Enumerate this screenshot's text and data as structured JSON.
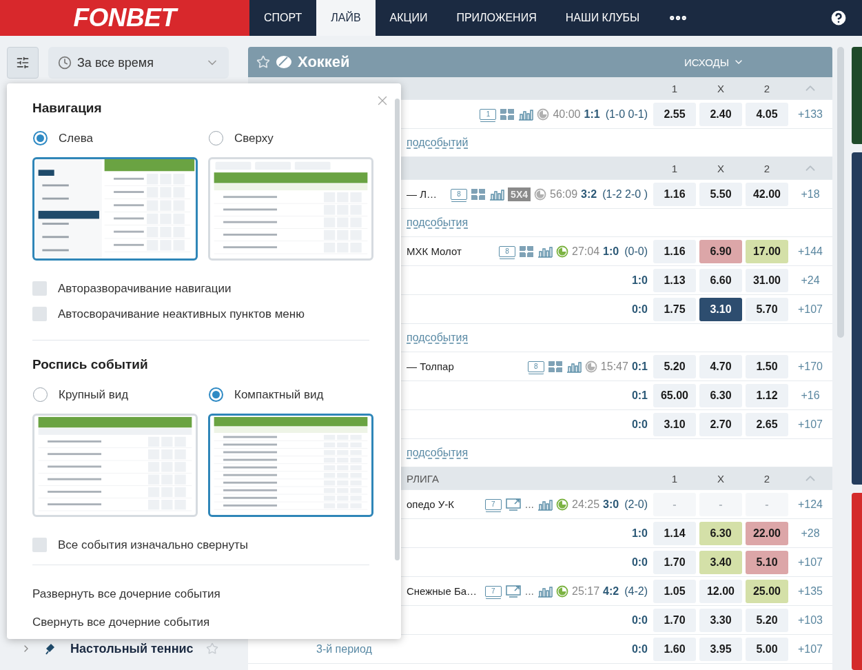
{
  "header": {
    "logo": "FONBET",
    "tabs": [
      {
        "label": "СПОРТ",
        "selected": false
      },
      {
        "label": "ЛАЙВ",
        "selected": true
      },
      {
        "label": "АКЦИИ",
        "selected": false
      },
      {
        "label": "ПРИЛОЖЕНИЯ",
        "selected": false
      },
      {
        "label": "НАШИ КЛУБЫ",
        "selected": false
      }
    ]
  },
  "sidebar": {
    "period_filter": "За все время",
    "bottom_item": "Настольный теннис"
  },
  "main": {
    "sport": "Хоккей",
    "market": "ИСХОДЫ",
    "blocks": [
      {
        "kind": "league",
        "columns": [
          "1",
          "X",
          "2"
        ]
      },
      {
        "kind": "event",
        "icons": [
          {
            "kind": "tv",
            "label": "1"
          },
          {
            "kind": "field"
          },
          {
            "kind": "stats"
          }
        ],
        "clock_live": false,
        "time": "40:00",
        "score": "1:1",
        "period": "(1-0 0-1)",
        "suspended": false,
        "odds": [
          {
            "value": "2.55",
            "selected": false,
            "color": "#eef2f6"
          },
          {
            "value": "2.40",
            "selected": false,
            "color": "#eef2f6"
          },
          {
            "value": "4.05",
            "selected": false,
            "color": "#eef2f6"
          }
        ],
        "more": "+133"
      },
      {
        "kind": "link",
        "text": "подсобытий"
      },
      {
        "kind": "league",
        "columns": [
          "1",
          "X",
          "2"
        ]
      },
      {
        "kind": "event",
        "name": "— Л…",
        "icons": [
          {
            "kind": "tv",
            "label": "8"
          },
          {
            "kind": "field"
          },
          {
            "kind": "stats"
          },
          {
            "kind": "badge",
            "label": "5X4"
          }
        ],
        "clock_live": false,
        "time": "56:09",
        "score": "3:2",
        "period": "(1-2 2-0 )",
        "suspended": false,
        "odds": [
          {
            "value": "1.16",
            "selected": false,
            "color": "#eef2f6"
          },
          {
            "value": "5.50",
            "selected": false,
            "color": "#eef2f6"
          },
          {
            "value": "42.00",
            "selected": false,
            "color": "#eef2f6"
          }
        ],
        "more": "+18"
      },
      {
        "kind": "link",
        "text": "подсобытия"
      },
      {
        "kind": "event",
        "name": "МХК Молот",
        "icons": [
          {
            "kind": "tv",
            "label": "8"
          },
          {
            "kind": "field"
          },
          {
            "kind": "stats"
          }
        ],
        "clock_live": true,
        "time": "27:04",
        "score": "1:0",
        "period": "(0-0)",
        "suspended": false,
        "odds": [
          {
            "value": "1.16",
            "selected": false,
            "color": "#eef2f6"
          },
          {
            "value": "6.90",
            "selected": false,
            "color": "#dca6a8"
          },
          {
            "value": "17.00",
            "selected": false,
            "color": "#d4e0a8"
          }
        ],
        "more": "+144"
      },
      {
        "kind": "sub",
        "score": "1:0",
        "odds": [
          {
            "value": "1.13",
            "selected": false,
            "color": "#eef2f6"
          },
          {
            "value": "6.60",
            "selected": false,
            "color": "#eef2f6"
          },
          {
            "value": "31.00",
            "selected": false,
            "color": "#eef2f6"
          }
        ],
        "more": "+24"
      },
      {
        "kind": "sub",
        "score": "0:0",
        "odds": [
          {
            "value": "1.75",
            "selected": false,
            "color": "#eef2f6"
          },
          {
            "value": "3.10",
            "selected": true,
            "color": "#2d4d6f"
          },
          {
            "value": "5.70",
            "selected": false,
            "color": "#eef2f6"
          }
        ],
        "more": "+107"
      },
      {
        "kind": "link",
        "text": "подсобытия"
      },
      {
        "kind": "event",
        "name": "— Толпар",
        "icons": [
          {
            "kind": "tv",
            "label": "8"
          },
          {
            "kind": "field"
          },
          {
            "kind": "stats"
          }
        ],
        "clock_live": false,
        "time": "15:47",
        "score": "0:1",
        "suspended": false,
        "odds": [
          {
            "value": "5.20",
            "selected": false,
            "color": "#eef2f6"
          },
          {
            "value": "4.70",
            "selected": false,
            "color": "#eef2f6"
          },
          {
            "value": "1.50",
            "selected": false,
            "color": "#eef2f6"
          }
        ],
        "more": "+170"
      },
      {
        "kind": "sub",
        "score": "0:1",
        "odds": [
          {
            "value": "65.00",
            "selected": false,
            "color": "#eef2f6"
          },
          {
            "value": "6.30",
            "selected": false,
            "color": "#eef2f6"
          },
          {
            "value": "1.12",
            "selected": false,
            "color": "#eef2f6"
          }
        ],
        "more": "+16"
      },
      {
        "kind": "sub",
        "score": "0:0",
        "odds": [
          {
            "value": "3.10",
            "selected": false,
            "color": "#eef2f6"
          },
          {
            "value": "2.70",
            "selected": false,
            "color": "#eef2f6"
          },
          {
            "value": "2.65",
            "selected": false,
            "color": "#eef2f6"
          }
        ],
        "more": "+107"
      },
      {
        "kind": "link",
        "text": "подсобытия"
      },
      {
        "kind": "league",
        "title": "РЛИГА",
        "columns": [
          "1",
          "X",
          "2"
        ]
      },
      {
        "kind": "event",
        "name": "опедо У-К",
        "icons": [
          {
            "kind": "tv",
            "label": "7"
          },
          {
            "kind": "screen"
          },
          {
            "kind": "more",
            "label": "..."
          },
          {
            "kind": "stats"
          }
        ],
        "clock_live": true,
        "time": "24:25",
        "score": "3:0",
        "period": "(2-0)",
        "suspended": true,
        "odds": [
          {
            "value": "-",
            "selected": false,
            "color": "#eef2f6"
          },
          {
            "value": "-",
            "selected": false,
            "color": "#eef2f6"
          },
          {
            "value": "-",
            "selected": false,
            "color": "#eef2f6"
          }
        ],
        "more": "+124"
      },
      {
        "kind": "sub",
        "score": "1:0",
        "odds": [
          {
            "value": "1.14",
            "selected": false,
            "color": "#eef2f6"
          },
          {
            "value": "6.30",
            "selected": false,
            "color": "#d4e0a8"
          },
          {
            "value": "22.00",
            "selected": false,
            "color": "#dca6a8"
          }
        ],
        "more": "+28"
      },
      {
        "kind": "sub",
        "score": "0:0",
        "odds": [
          {
            "value": "1.70",
            "selected": false,
            "color": "#eef2f6"
          },
          {
            "value": "3.40",
            "selected": false,
            "color": "#d4e0a8"
          },
          {
            "value": "5.10",
            "selected": false,
            "color": "#dca6a8"
          }
        ],
        "more": "+107"
      },
      {
        "kind": "event",
        "name": "Снежные Ба…",
        "icons": [
          {
            "kind": "tv",
            "label": "7"
          },
          {
            "kind": "screen"
          },
          {
            "kind": "more",
            "label": "..."
          },
          {
            "kind": "stats"
          }
        ],
        "clock_live": true,
        "time": "25:17",
        "score": "4:2",
        "period": "(4-2)",
        "suspended": false,
        "odds": [
          {
            "value": "1.05",
            "selected": false,
            "color": "#eef2f6"
          },
          {
            "value": "12.00",
            "selected": false,
            "color": "#eef2f6"
          },
          {
            "value": "25.00",
            "selected": false,
            "color": "#d4e0a8"
          }
        ],
        "more": "+135"
      },
      {
        "kind": "sub",
        "score": "0:0",
        "odds": [
          {
            "value": "1.70",
            "selected": false,
            "color": "#eef2f6"
          },
          {
            "value": "3.30",
            "selected": false,
            "color": "#eef2f6"
          },
          {
            "value": "5.20",
            "selected": false,
            "color": "#eef2f6"
          }
        ],
        "more": "+103"
      },
      {
        "kind": "sub",
        "label": "3-й период",
        "score": "0:0",
        "odds": [
          {
            "value": "1.60",
            "selected": false,
            "color": "#eef2f6"
          },
          {
            "value": "3.95",
            "selected": false,
            "color": "#eef2f6"
          },
          {
            "value": "5.00",
            "selected": false,
            "color": "#eef2f6"
          }
        ],
        "more": "+107"
      }
    ]
  },
  "settings_popup": {
    "sections": [
      {
        "title": "Навигация",
        "options": [
          {
            "label": "Слева",
            "selected": true,
            "kind": "left"
          },
          {
            "label": "Сверху",
            "selected": false,
            "kind": "top"
          }
        ],
        "toggles": [
          {
            "label": "Авторазворачивание навигации",
            "checked": false
          },
          {
            "label": "Автосворачивание неактивных пунктов меню",
            "checked": false
          }
        ]
      },
      {
        "title": "Роспись событий",
        "options": [
          {
            "label": "Крупный вид",
            "selected": false,
            "kind": "large"
          },
          {
            "label": "Компактный вид",
            "selected": true,
            "kind": "compact"
          }
        ],
        "toggles": [
          {
            "label": "Все события изначально свернуты",
            "checked": false
          }
        ]
      }
    ],
    "actions": [
      "Развернуть все дочерние события",
      "Свернуть все дочерние события"
    ]
  }
}
